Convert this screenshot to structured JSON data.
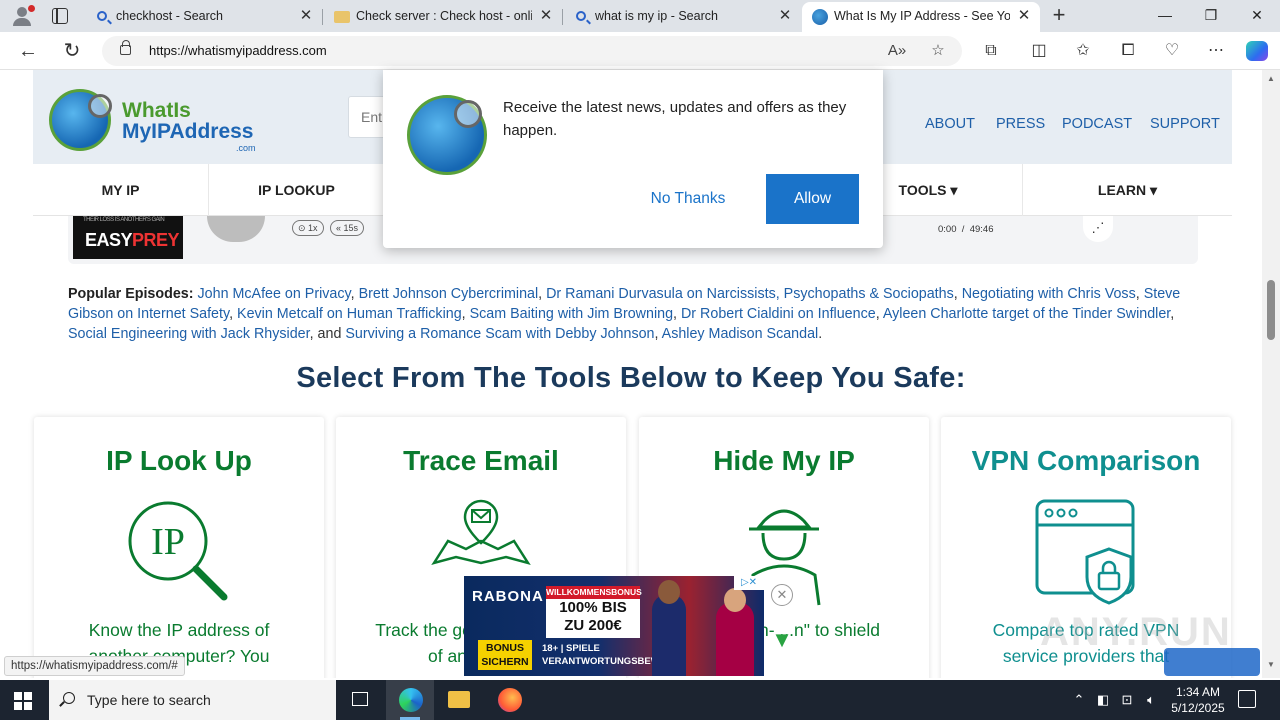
{
  "browser": {
    "tabs": [
      {
        "title": "checkhost - Search",
        "icon": "search-icon"
      },
      {
        "title": "Check server : Check host - online",
        "icon": "folder-icon"
      },
      {
        "title": "what is my ip - Search",
        "icon": "search-icon"
      },
      {
        "title": "What Is My IP Address - See Your",
        "icon": "globe-icon",
        "active": true
      }
    ],
    "tab_close_glyph": "✕",
    "url_host": "https://whatismyipaddress.com",
    "status_url": "https://whatismyipaddress.com/#"
  },
  "site": {
    "logo": {
      "line1": "WhatIs",
      "line2": "MyIPAddress",
      "line3": ".com"
    },
    "search_placeholder": "Ent",
    "top_links": [
      "ABOUT",
      "PRESS",
      "PODCAST",
      "SUPPORT"
    ],
    "nav": [
      "MY IP",
      "IP LOOKUP",
      "TOOLS ▾",
      "LEARN ▾"
    ]
  },
  "podcast": {
    "art_small": "THEIR LOSS IS ANOTHER'S GAIN",
    "art_title_a": "EASY",
    "art_title_b": "PREY",
    "speed": "1x",
    "back": "15s",
    "time_current": "0:00",
    "time_total": "49:46"
  },
  "popular": {
    "label": "Popular Episodes:",
    "links": [
      "John McAfee on Privacy",
      "Brett Johnson Cybercriminal",
      "Dr Ramani Durvasula on Narcissists, Psychopaths & Sociopaths",
      "Negotiating with Chris Voss",
      "Steve Gibson on Internet Safety",
      "Kevin Metcalf on Human Trafficking",
      "Scam Baiting with Jim Browning",
      "Dr Robert Cialdini on Influence",
      "Ayleen Charlotte target of the Tinder Swindler",
      "Social Engineering with Jack Rhysider",
      "Surviving a Romance Scam with Debby Johnson",
      "Ashley Madison Scandal"
    ],
    "and_word": ", and "
  },
  "tools": {
    "title": "Select From The Tools Below to Keep You Safe:",
    "cards": [
      {
        "title": "IP Look Up",
        "text": "Know the IP address of another computer? You",
        "color": "#0a7b2f"
      },
      {
        "title": "Trace Email",
        "text": "Track the geographic origin of an email re",
        "color": "#0a7b2f"
      },
      {
        "title": "Hide My IP",
        "text": "use a high- ...n\" to shield",
        "color": "#0a7b2f"
      },
      {
        "title": "VPN Comparison",
        "text": "Compare top rated VPN service providers that",
        "color": "#0f8f8f"
      }
    ]
  },
  "notification": {
    "message": "Receive the latest news, updates and offers as they happen.",
    "no_label": "No Thanks",
    "allow_label": "Allow"
  },
  "ad": {
    "brand": "RABONA",
    "headline": "WILLKOMMENSBONUS",
    "line1": "100% BIS",
    "line2": "ZU 200€",
    "cta": "BONUS SICHERN",
    "legal1": "18+ | SPIELE",
    "legal2": "VERANTWORTUNGSBEWU",
    "adchoice": "▷✕"
  },
  "watermark": "ANY.RUN",
  "taskbar": {
    "search_placeholder": "Type here to search",
    "time": "1:34 AM",
    "date": "5/12/2025"
  }
}
